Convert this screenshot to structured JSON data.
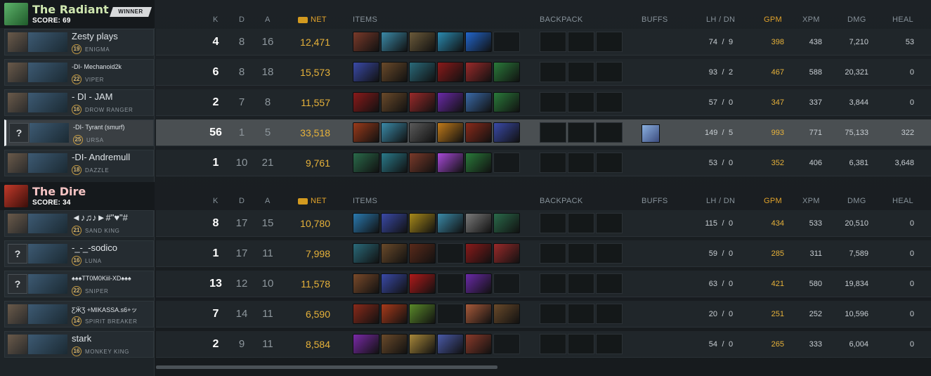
{
  "radiant": {
    "name": "The Radiant",
    "score_text": "SCORE: 69",
    "badge": "WINNER",
    "players": [
      {
        "name": "Zesty plays",
        "level": "19",
        "hero": "ENIGMA",
        "k": "4",
        "d": "8",
        "a": "16",
        "net": "12,471",
        "lh": "74",
        "dn": "9",
        "gpm": "398",
        "xpm": "438",
        "dmg": "7,210",
        "heal": "53",
        "items": [
          "#7a3a2a",
          "#3b8aa8",
          "#6b5a3a",
          "#2a8ab0",
          "#2266cc",
          "empty"
        ],
        "buff": false,
        "unknown": false,
        "small": false
      },
      {
        "name": "-DI- Mechanoid2k",
        "level": "22",
        "hero": "VIPER",
        "k": "6",
        "d": "8",
        "a": "18",
        "net": "15,573",
        "lh": "93",
        "dn": "2",
        "gpm": "467",
        "xpm": "588",
        "dmg": "20,321",
        "heal": "0",
        "items": [
          "#3a4aa8",
          "#6a4a2a",
          "#2a6a7a",
          "#8a1a1a",
          "#9a2a2a",
          "#2a7a3a"
        ],
        "buff": false,
        "unknown": false,
        "small": true
      },
      {
        "name": "- DI - JAM",
        "level": "16",
        "hero": "DROW RANGER",
        "k": "2",
        "d": "7",
        "a": "8",
        "net": "11,557",
        "lh": "57",
        "dn": "0",
        "gpm": "347",
        "xpm": "337",
        "dmg": "3,844",
        "heal": "0",
        "items": [
          "#8a1a1a",
          "#6a4a2a",
          "#9a2a2a",
          "#6a2aa8",
          "#3a6aa8",
          "#2a7a3a"
        ],
        "buff": false,
        "unknown": false,
        "small": false
      },
      {
        "name": "-DI- Tyrant (smurf)",
        "level": "25",
        "hero": "URSA",
        "k": "56",
        "d": "1",
        "a": "5",
        "net": "33,518",
        "lh": "149",
        "dn": "5",
        "gpm": "993",
        "xpm": "771",
        "dmg": "75,133",
        "heal": "322",
        "items": [
          "#9a3a1a",
          "#3b8aa8",
          "#5a5a5a",
          "#c07a1a",
          "#8a2a1a",
          "#3a4aa8"
        ],
        "buff": true,
        "unknown": true,
        "small": true
      },
      {
        "name": "-DI- Andremull",
        "level": "18",
        "hero": "DAZZLE",
        "k": "1",
        "d": "10",
        "a": "21",
        "net": "9,761",
        "lh": "53",
        "dn": "0",
        "gpm": "352",
        "xpm": "406",
        "dmg": "6,381",
        "heal": "3,648",
        "items": [
          "#2a6a4a",
          "#2a7a8a",
          "#7a3a2a",
          "#a84ad8",
          "#2a7a3a",
          "empty"
        ],
        "buff": false,
        "unknown": false,
        "small": false
      }
    ]
  },
  "dire": {
    "name": "The Dire",
    "score_text": "SCORE: 34",
    "players": [
      {
        "name": "◄♪♫♪►#\"♥\"#",
        "level": "21",
        "hero": "SAND KING",
        "k": "8",
        "d": "17",
        "a": "15",
        "net": "10,780",
        "lh": "115",
        "dn": "0",
        "gpm": "434",
        "xpm": "533",
        "dmg": "20,510",
        "heal": "0",
        "items": [
          "#2a7ab0",
          "#3a4aa8",
          "#a88a1a",
          "#3b8aa8",
          "#7a7a7a",
          "#2a6a4a"
        ],
        "buff": false,
        "unknown": false,
        "small": false
      },
      {
        "name": "-_-_-sodico",
        "level": "16",
        "hero": "LUNA",
        "k": "1",
        "d": "17",
        "a": "11",
        "net": "7,998",
        "lh": "59",
        "dn": "0",
        "gpm": "285",
        "xpm": "311",
        "dmg": "7,589",
        "heal": "0",
        "items": [
          "#2a6a7a",
          "#6a4a2a",
          "#5a2a1a",
          "empty",
          "#8a1a1a",
          "#9a2a2a"
        ],
        "buff": false,
        "unknown": true,
        "small": false
      },
      {
        "name": "♠♠♠TT0M0Kiil-XD♠♠♠",
        "level": "22",
        "hero": "SNIPER",
        "k": "13",
        "d": "12",
        "a": "10",
        "net": "11,578",
        "lh": "63",
        "dn": "0",
        "gpm": "421",
        "xpm": "580",
        "dmg": "19,834",
        "heal": "0",
        "items": [
          "#7a4a2a",
          "#3a4aa8",
          "#b01a1a",
          "empty",
          "#6a2aa8",
          "empty"
        ],
        "buff": false,
        "unknown": true,
        "small": true
      },
      {
        "name": "ƸӜƷ +MIKASSA.s6+ッ",
        "level": "14",
        "hero": "SPIRIT BREAKER",
        "k": "7",
        "d": "14",
        "a": "11",
        "net": "6,590",
        "lh": "20",
        "dn": "0",
        "gpm": "251",
        "xpm": "252",
        "dmg": "10,596",
        "heal": "0",
        "items": [
          "#8a2a1a",
          "#a83a1a",
          "#5a8a2a",
          "empty",
          "#a85a3a",
          "#6a4a2a"
        ],
        "buff": false,
        "unknown": false,
        "small": true
      },
      {
        "name": "stark",
        "level": "16",
        "hero": "MONKEY KING",
        "k": "2",
        "d": "9",
        "a": "11",
        "net": "8,584",
        "lh": "54",
        "dn": "0",
        "gpm": "265",
        "xpm": "333",
        "dmg": "6,004",
        "heal": "0",
        "items": [
          "#7a2aa8",
          "#6a4a2a",
          "#a8883a",
          "#4a5aa8",
          "#8a3a2a",
          "empty"
        ],
        "buff": false,
        "unknown": false,
        "small": false
      }
    ]
  },
  "headers": {
    "k": "K",
    "d": "D",
    "a": "A",
    "net": "NET",
    "items": "ITEMS",
    "backpack": "BACKPACK",
    "buffs": "BUFFS",
    "lhdn": "LH / DN",
    "gpm": "GPM",
    "xpm": "XPM",
    "dmg": "DMG",
    "heal": "HEAL"
  },
  "colors": {
    "radiant_name": "#cfe7b0",
    "dire_name": "#f5c4c4",
    "gold": "#e7b23a"
  }
}
